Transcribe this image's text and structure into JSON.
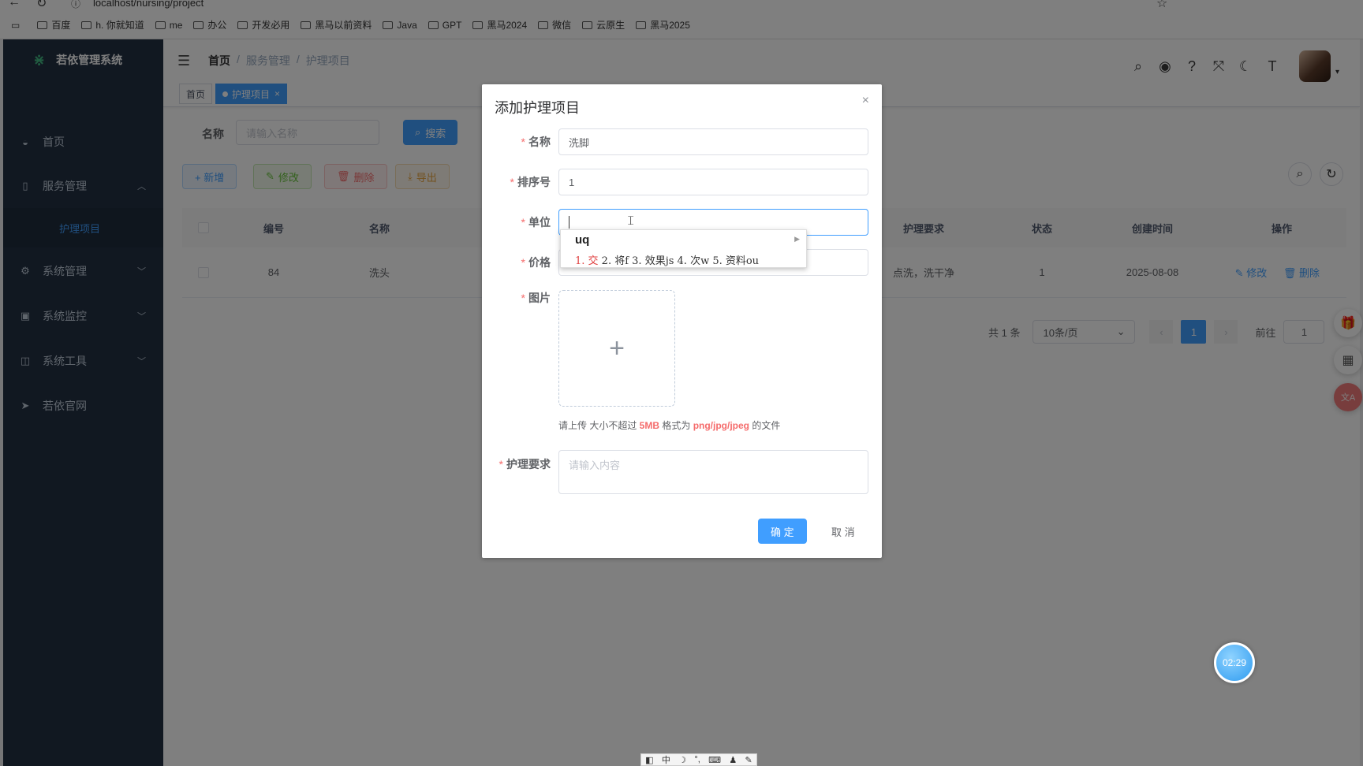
{
  "browser": {
    "url": "localhost/nursing/project",
    "bookmarks": [
      "百度",
      "h. 你就知道",
      "me",
      "办公",
      "开发必用",
      "黑马以前资料",
      "Java",
      "GPT",
      "黑马2024",
      "微信",
      "云原生",
      "黑马2025"
    ]
  },
  "sidebar": {
    "title": "若依管理系统",
    "items": [
      {
        "label": "首页",
        "icon": "dashboard-icon"
      },
      {
        "label": "服务管理",
        "icon": "service-icon",
        "expanded": true
      },
      {
        "label": "系统管理",
        "icon": "gear-icon"
      },
      {
        "label": "系统监控",
        "icon": "monitor-icon"
      },
      {
        "label": "系统工具",
        "icon": "tool-icon"
      },
      {
        "label": "若依官网",
        "icon": "send-icon"
      }
    ],
    "submenu_active": "护理项目"
  },
  "header": {
    "breadcrumb": [
      "首页",
      "服务管理",
      "护理项目"
    ],
    "separator": "/"
  },
  "tags": {
    "home": "首页",
    "active": "护理项目",
    "close": "×"
  },
  "search": {
    "name_label": "名称",
    "name_placeholder": "请输入名称",
    "search_button": "搜索"
  },
  "toolbar": {
    "add": "+ 新增",
    "edit": "修改",
    "delete": "删除",
    "export": "导出"
  },
  "table": {
    "headers": [
      "编号",
      "名称",
      "护理要求",
      "状态",
      "创建时间",
      "操作"
    ],
    "rows": [
      {
        "id": "84",
        "name": "洗头",
        "requirement": "点洗，洗干净",
        "status": "1",
        "created": "2025-08-08",
        "edit": "修改",
        "delete": "删除"
      }
    ]
  },
  "pagination": {
    "total": "共 1 条",
    "page_size": "10条/页",
    "current_page": "1",
    "goto_label": "前往",
    "goto_value": "1"
  },
  "dialog": {
    "title": "添加护理项目",
    "close": "×",
    "fields": {
      "name_label": "名称",
      "name_value": "洗脚",
      "order_label": "排序号",
      "order_value": "1",
      "unit_label": "单位",
      "unit_value": "",
      "price_label": "价格",
      "image_label": "图片",
      "image_plus": "+",
      "requirement_label": "护理要求",
      "requirement_placeholder": "请输入内容"
    },
    "upload_tip_prefix": "请上传 大小不超过 ",
    "upload_tip_size": "5MB",
    "upload_tip_middle": " 格式为 ",
    "upload_tip_formats": "png/jpg/jpeg",
    "upload_tip_suffix": " 的文件",
    "confirm": "确 定",
    "cancel": "取 消"
  },
  "ime": {
    "composition": "uq",
    "first_candidate": "1. 交",
    "candidates": " 2. 将f 3. 效果js 4. 次w 5. 资料ou",
    "toolbar": [
      "中"
    ]
  },
  "timer": "02:29",
  "colors": {
    "primary": "#409eff",
    "sidebar": "#233043",
    "danger": "#f56c6c"
  }
}
